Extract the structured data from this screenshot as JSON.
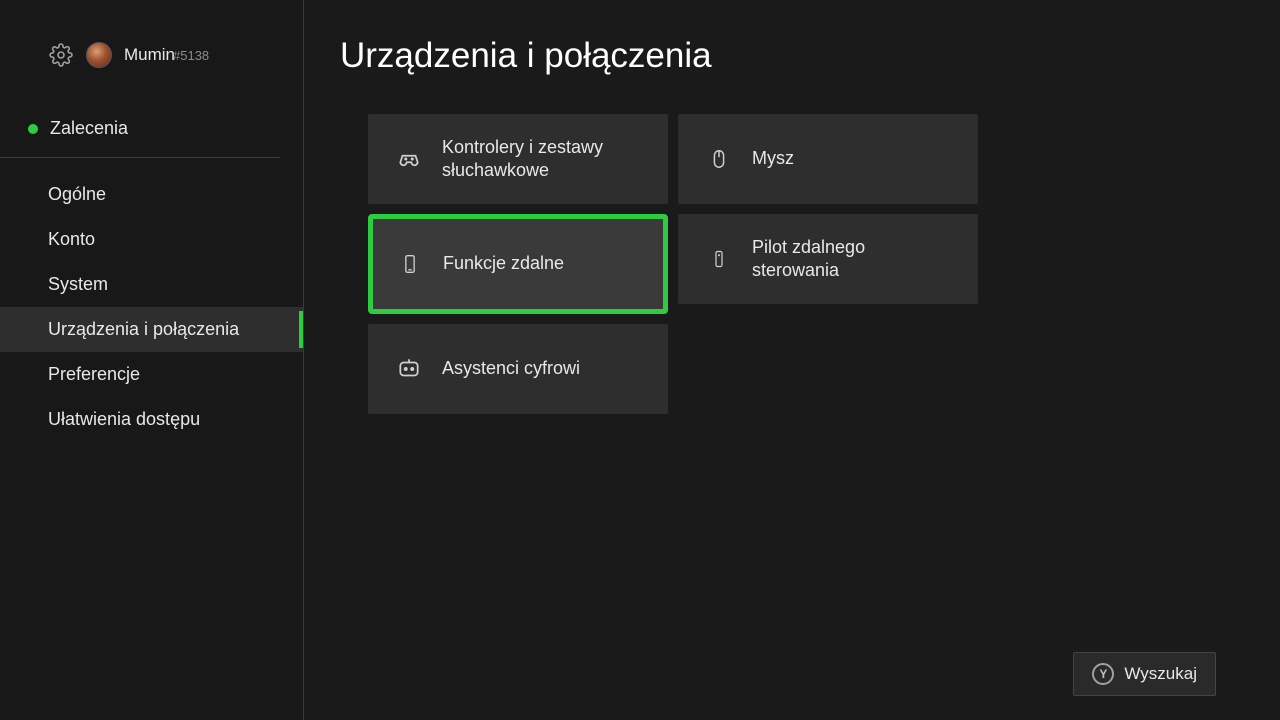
{
  "profile": {
    "username": "Mumin",
    "tag": "#5138"
  },
  "sidebar": {
    "recommendations_label": "Zalecenia",
    "items": [
      {
        "label": "Ogólne"
      },
      {
        "label": "Konto"
      },
      {
        "label": "System"
      },
      {
        "label": "Urządzenia i połączenia"
      },
      {
        "label": "Preferencje"
      },
      {
        "label": "Ułatwienia dostępu"
      }
    ]
  },
  "main": {
    "title": "Urządzenia i połączenia",
    "tiles": [
      {
        "label": "Kontrolery i zestawy słuchawkowe",
        "icon": "controller"
      },
      {
        "label": "Mysz",
        "icon": "mouse"
      },
      {
        "label": "Funkcje zdalne",
        "icon": "phone",
        "focused": true
      },
      {
        "label": "Pilot zdalnego sterowania",
        "icon": "remote"
      },
      {
        "label": "Asystenci cyfrowi",
        "icon": "assistant"
      }
    ]
  },
  "search": {
    "button_glyph": "Y",
    "label": "Wyszukaj"
  }
}
